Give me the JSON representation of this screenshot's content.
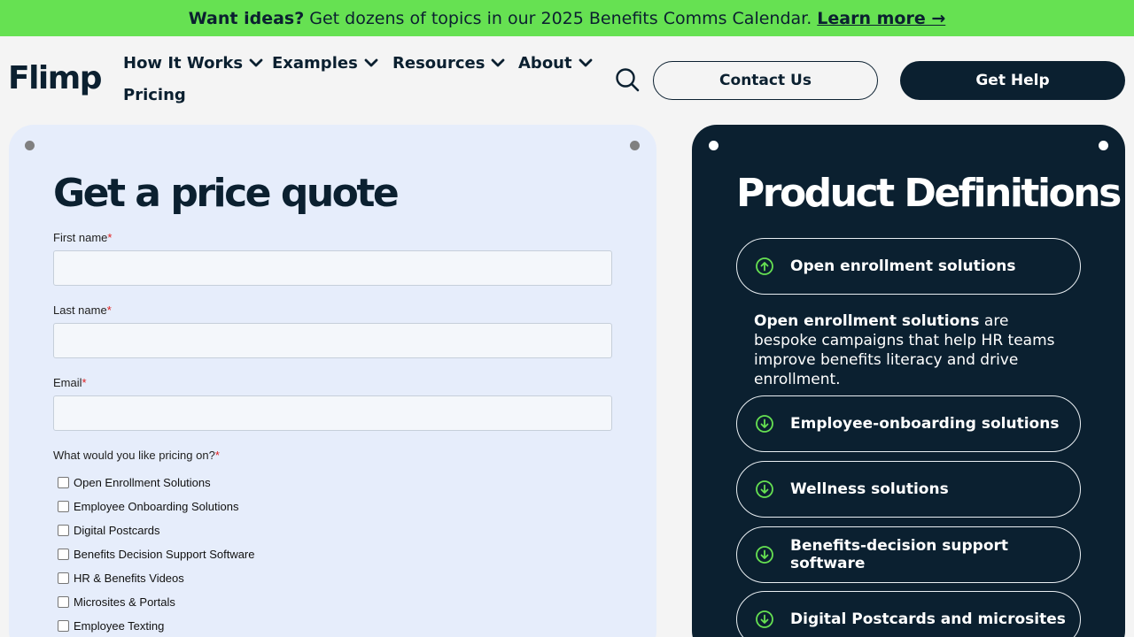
{
  "promo": {
    "bold": "Want ideas?",
    "text": "Get dozens of topics in our 2025 Benefits Comms Calendar.",
    "link": "Learn more →"
  },
  "header": {
    "logo": "Flimp",
    "nav": [
      {
        "label": "How It Works"
      },
      {
        "label": "Examples"
      },
      {
        "label": "Resources"
      },
      {
        "label": "About"
      }
    ],
    "pricing": "Pricing",
    "contact_label": "Contact Us",
    "help_label": "Get Help"
  },
  "form": {
    "title": "Get a price quote",
    "first_name_label": "First name",
    "last_name_label": "Last name",
    "email_label": "Email",
    "pricing_question": "What would you like pricing on?",
    "required_mark": "*",
    "options": [
      "Open Enrollment Solutions",
      "Employee Onboarding Solutions",
      "Digital Postcards",
      "Benefits Decision Support Software",
      "HR & Benefits Videos",
      "Microsites & Portals",
      "Employee Texting"
    ]
  },
  "definitions": {
    "title": "Product Definitions",
    "open_item": {
      "label": "Open enrollment solutions",
      "body_bold": "Open enrollment solutions",
      "body_text": "are bespoke campaigns that help HR teams improve benefits literacy and drive enrollment."
    },
    "items": [
      "Employee-onboarding solutions",
      "Wellness solutions",
      "Benefits-decision support software",
      "Digital Postcards and microsites"
    ]
  },
  "colors": {
    "promo_bg": "#66e152",
    "navy": "#0b2030",
    "form_card_bg": "#e6edfb",
    "accent_green": "#66e152",
    "required": "#e02020"
  }
}
